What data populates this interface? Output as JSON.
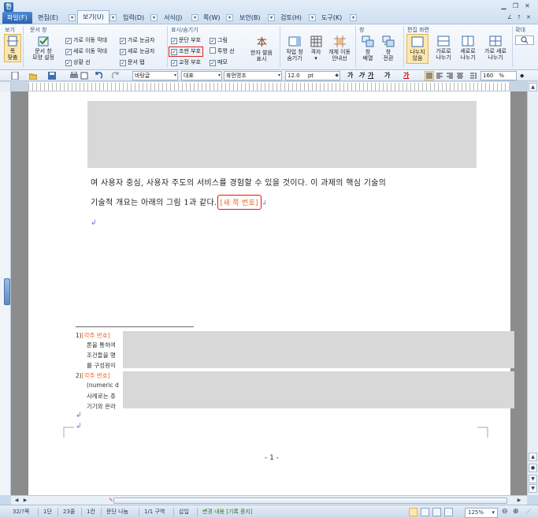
{
  "menubar": {
    "tabs": [
      {
        "label": "파일(F)",
        "kind": "file"
      },
      {
        "label": "편집(E)"
      },
      {
        "label": "보기(U)",
        "kind": "active"
      },
      {
        "label": "입력(D)"
      },
      {
        "label": "서식(J)"
      },
      {
        "label": "쪽(W)"
      },
      {
        "label": "보안(B)"
      },
      {
        "label": "검토(H)"
      },
      {
        "label": "도구(K)"
      }
    ],
    "help": "?"
  },
  "ribbon": {
    "groups": {
      "view": "보기",
      "doc_window": "문서 창",
      "show_hide": "표시/숨기기",
      "window": "창",
      "edit_screen": "편집 화면",
      "zoom": "확대"
    },
    "buttons": {
      "page_width": "폭\n맞춤",
      "doc_window_settings": "문서 창\n모양 설정",
      "hanja_reading": "한자 발음\n표시",
      "task_window": "작업 창\n숨기기",
      "grid": "격자",
      "object_move": "개체 이동\n안내선",
      "window_arrange": "창\n배열",
      "window_switch": "창\n전환",
      "no_split": "나누지\n않음",
      "split_horizontal": "가로로\n나누기",
      "split_vertical": "세로로\n나누기",
      "split_both": "가로 세로\n나누기"
    },
    "checks": [
      {
        "label": "가로 이동 막대",
        "checked": true
      },
      {
        "label": "세로 이동 막대",
        "checked": true
      },
      {
        "label": "상황 선",
        "checked": true
      },
      {
        "label": "가로 눈금자",
        "checked": true
      },
      {
        "label": "세로 눈금자",
        "checked": true
      },
      {
        "label": "문서 탭",
        "checked": true
      },
      {
        "label": "문단 부호",
        "checked": true
      },
      {
        "label": "조판 부호",
        "checked": true
      },
      {
        "label": "교정 부호",
        "checked": true
      },
      {
        "label": "그림",
        "checked": true
      },
      {
        "label": "투명 선",
        "checked": false
      },
      {
        "label": "메모",
        "checked": true
      }
    ]
  },
  "toolbar": {
    "style": "바탕글",
    "lang": "대표",
    "font": "휴먼명조",
    "size": "12.0",
    "size_unit": "pt",
    "format_labels": [
      "가",
      "가",
      "가",
      "가",
      "가"
    ],
    "zoom": "160",
    "zoom_unit": "%"
  },
  "document": {
    "line1": "여 사용자 중심, 사용자 주도의 서비스를 경험할 수 있을 것이다. 이 과제의 핵심 기술의",
    "line2": "기술적 개요는 아래의 그림 1과 같다.",
    "callout": "[새 쪽 번호]",
    "para_mark": "↲",
    "footnotes": [
      {
        "num": "1)",
        "tag": "[각주 번호]",
        "lines": [
          "론을 통하여",
          "조건들을 명",
          "를 구성원이"
        ]
      },
      {
        "num": "2)",
        "tag": "[각주 번호]",
        "lines": [
          "(numeric d",
          "사례로는 쥬",
          "기기와 온라"
        ]
      }
    ],
    "page_number": "- 1 -"
  },
  "statusbar": {
    "page": "32/?쪽",
    "column": "1단",
    "line": "23줄",
    "col": "1칸",
    "split": "문단 나눔",
    "section": "1/1 구역",
    "insert": "삽입",
    "track": "변경 내용 [기록 중지]",
    "zoom": "125%"
  },
  "colors": {
    "accent": "#2a63b0",
    "callout_border": "#e11111",
    "callout_text": "#f0641e",
    "track_text": "#2a7a1f"
  }
}
